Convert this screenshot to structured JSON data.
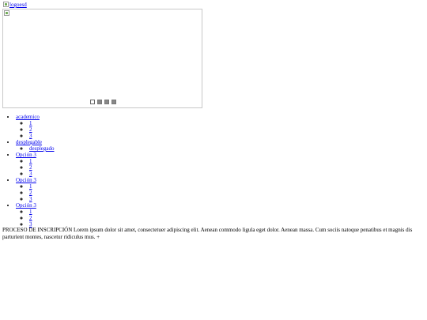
{
  "header": {
    "logo_alt": "logoesd"
  },
  "slider": {
    "image_alt": "",
    "pager": [
      {
        "label": "1",
        "active": true
      },
      {
        "label": "2",
        "active": false
      },
      {
        "label": "3",
        "active": false
      },
      {
        "label": "4",
        "active": false
      }
    ]
  },
  "menu": [
    {
      "label": "academico",
      "children": [
        "1",
        "2",
        "3"
      ]
    },
    {
      "label": "desplegable",
      "children": [
        "desplegado"
      ]
    },
    {
      "label": "Opción 3",
      "children": [
        "1",
        "2",
        "3"
      ]
    },
    {
      "label": "Opción 3",
      "children": [
        "1",
        "2",
        "3"
      ]
    },
    {
      "label": "Opción 3",
      "children": [
        "1",
        "2",
        "3"
      ]
    }
  ],
  "intro": {
    "text": "PROCESO DE INSCRIPCIÓN Lorem ipsum dolor sit amet, consectetuer adipiscing elit. Aenean commodo ligula eget dolor. Aenean massa. Cum sociis natoque penatibus et magnis dis parturient montes, nascetur ridiculus mus.",
    "more_label": "+"
  }
}
